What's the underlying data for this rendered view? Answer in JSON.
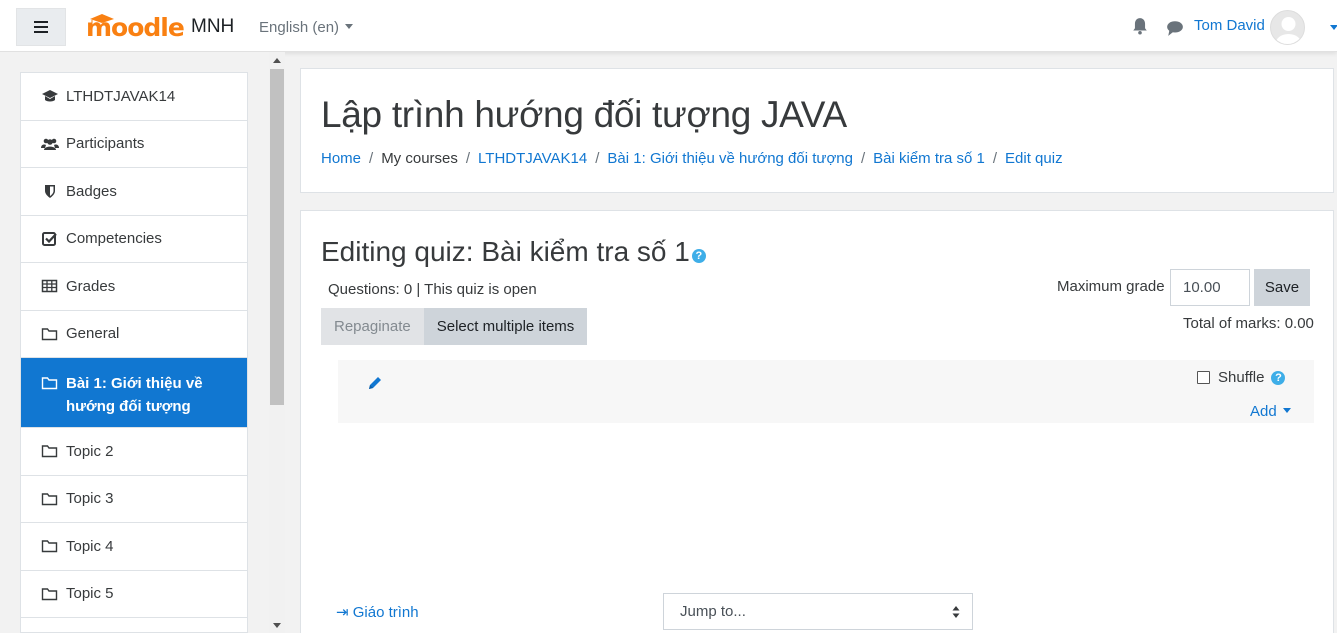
{
  "navbar": {
    "logo_text": "moodle",
    "site_name": "MNH",
    "language": "English (en)",
    "user_name": "Tom David"
  },
  "drawer": {
    "items": [
      {
        "label": "LTHDTJAVAK14",
        "icon": "graduation-cap-icon"
      },
      {
        "label": "Participants",
        "icon": "users-icon"
      },
      {
        "label": "Badges",
        "icon": "shield-icon"
      },
      {
        "label": "Competencies",
        "icon": "check-square-icon"
      },
      {
        "label": "Grades",
        "icon": "table-icon"
      },
      {
        "label": "General",
        "icon": "folder-icon"
      },
      {
        "label": "Bài 1: Giới thiệu về hướng đối tượng",
        "icon": "folder-icon",
        "active": true
      },
      {
        "label": "Topic 2",
        "icon": "folder-icon"
      },
      {
        "label": "Topic 3",
        "icon": "folder-icon"
      },
      {
        "label": "Topic 4",
        "icon": "folder-icon"
      },
      {
        "label": "Topic 5",
        "icon": "folder-icon"
      }
    ]
  },
  "header": {
    "course_title": "Lập trình hướng đối tượng JAVA",
    "breadcrumb": {
      "home": "Home",
      "my_courses": "My courses",
      "course": "LTHDTJAVAK14",
      "section": "Bài 1: Giới thiệu về hướng đối tượng",
      "quiz": "Bài kiểm tra số 1",
      "current": "Edit quiz"
    }
  },
  "main": {
    "quiz_title": "Editing quiz: Bài kiểm tra số 1",
    "status": "Questions: 0 | This quiz is open",
    "repaginate_label": "Repaginate",
    "select_multiple_label": "Select multiple items",
    "max_grade_label": "Maximum grade",
    "max_grade_value": "10.00",
    "save_label": "Save",
    "total_marks": "Total of marks: 0.00",
    "shuffle_label": "Shuffle",
    "shuffle_checked": false,
    "add_label": "Add",
    "prev_link": "Giáo trình",
    "jump_to": "Jump to..."
  },
  "colors": {
    "accent": "#1177d1",
    "logo_orange": "#f98012",
    "help_icon": "#3eaee8"
  }
}
